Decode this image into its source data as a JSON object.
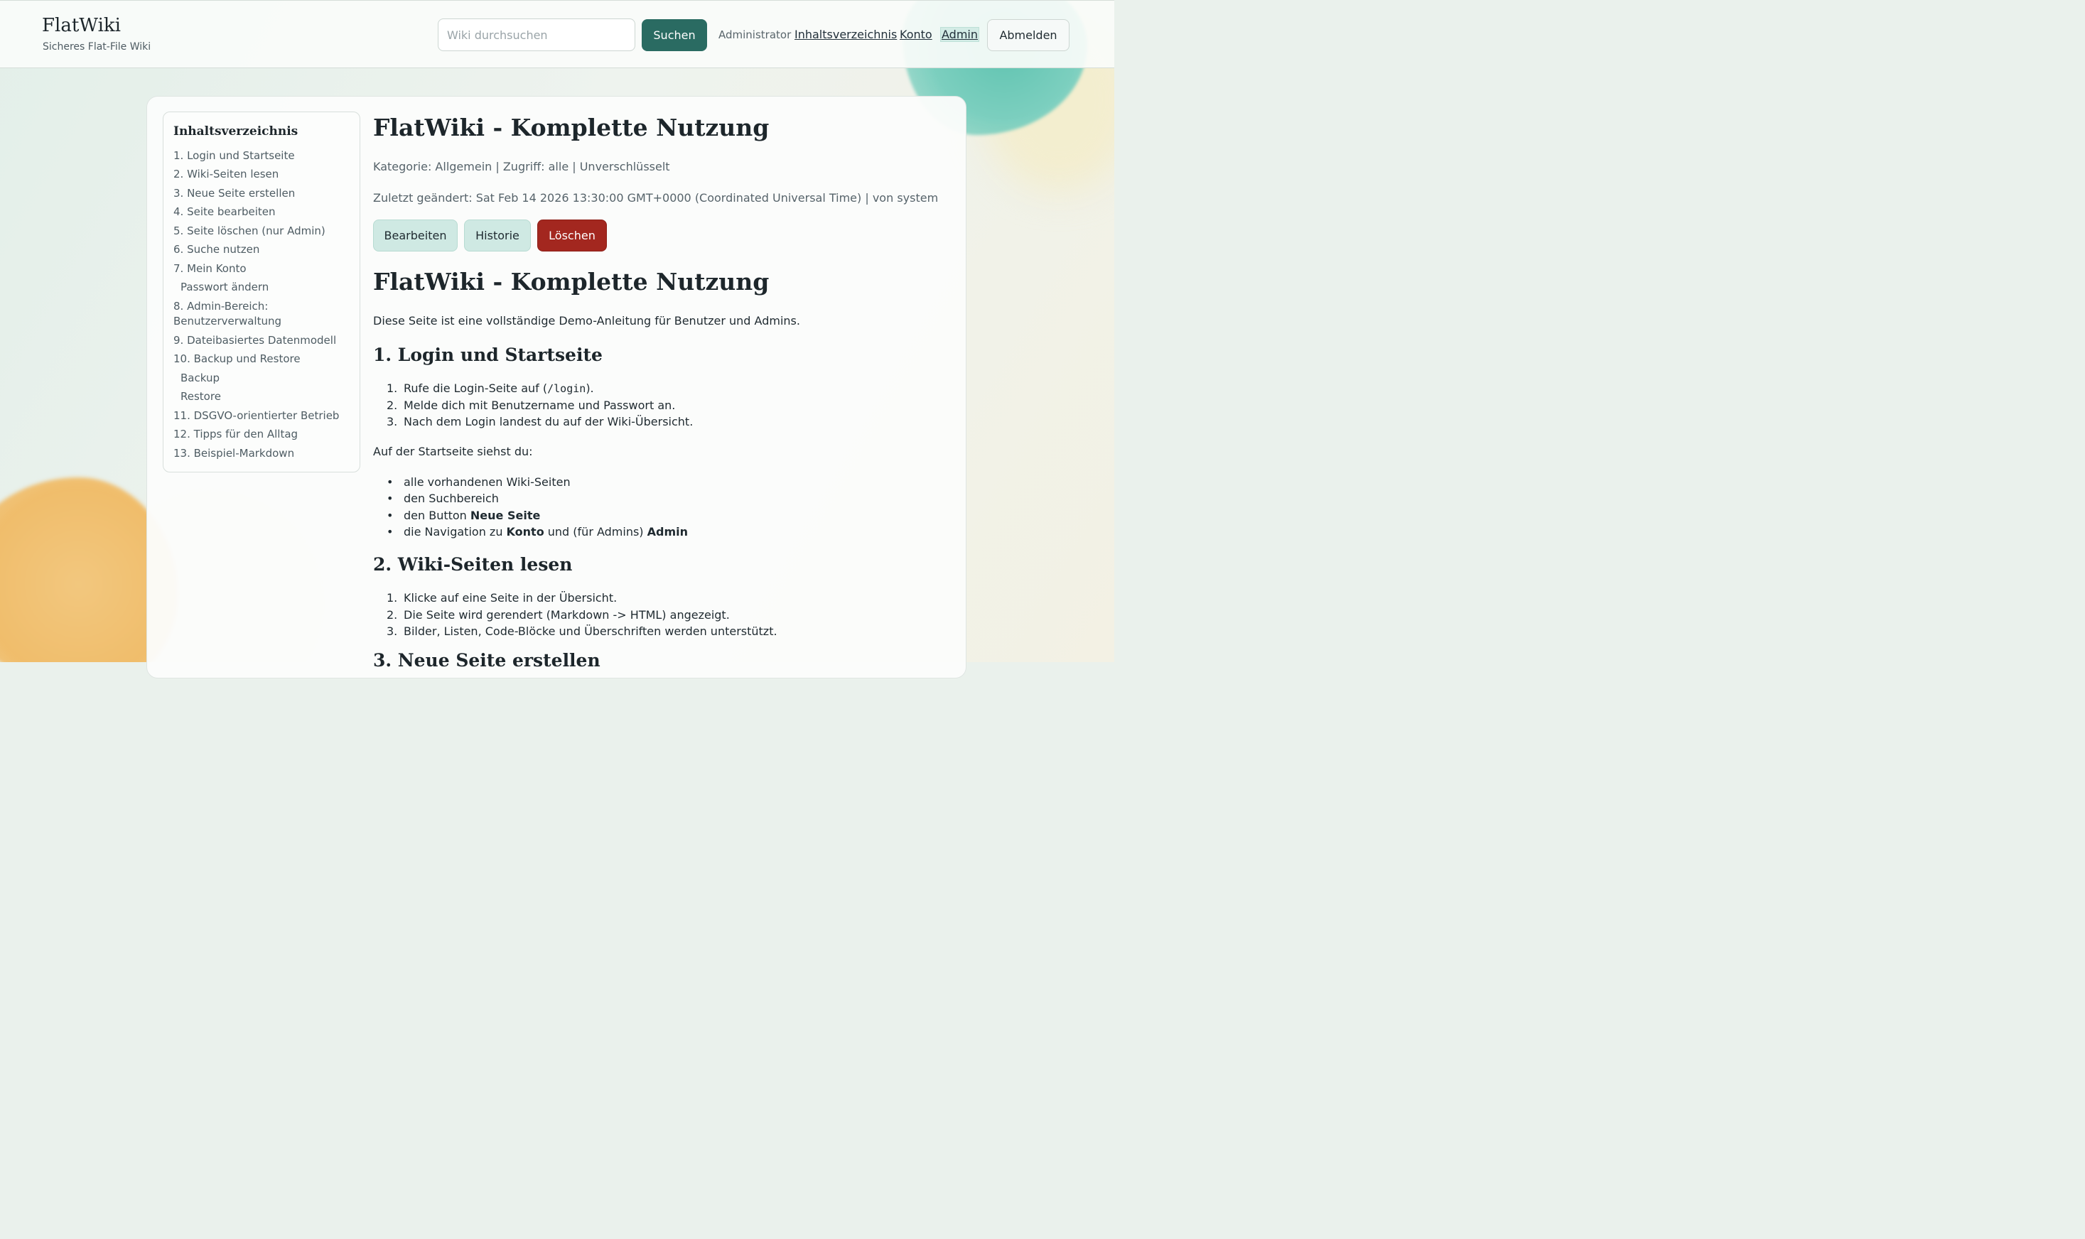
{
  "header": {
    "brand_title": "FlatWiki",
    "brand_subtitle": "Sicheres Flat-File Wiki",
    "search_placeholder": "Wiki durchsuchen",
    "search_button": "Suchen",
    "user": "Administrator",
    "nav": [
      "Inhaltsverzeichnis",
      "Konto",
      "Admin"
    ],
    "logout": "Abmelden"
  },
  "toc": {
    "title": "Inhaltsverzeichnis",
    "items": [
      "1. Login und Startseite",
      "2. Wiki-Seiten lesen",
      "3. Neue Seite erstellen",
      "4. Seite bearbeiten",
      "5. Seite löschen (nur Admin)",
      "6. Suche nutzen",
      "7. Mein Konto",
      "Passwort ändern",
      "8. Admin-Bereich: Benutzerverwaltung",
      "9. Dateibasiertes Datenmodell",
      "10. Backup und Restore",
      "Backup",
      "Restore",
      "11. DSGVO-orientierter Betrieb",
      "12. Tipps für den Alltag",
      "13. Beispiel-Markdown"
    ]
  },
  "page": {
    "title": "FlatWiki - Komplette Nutzung",
    "meta_category": "Kategorie: Allgemein | Zugriff: alle | Unverschlüsselt",
    "meta_changed": "Zuletzt geändert: Sat Feb 14 2026 13:30:00 GMT+0000 (Coordinated Universal Time) | von system",
    "actions": {
      "edit": "Bearbeiten",
      "history": "Historie",
      "delete": "Löschen"
    }
  },
  "content": {
    "h1": "FlatWiki - Komplette Nutzung",
    "intro": "Diese Seite ist eine vollständige Demo-Anleitung für Benutzer und Admins.",
    "section1": {
      "heading": "1. Login und Startseite",
      "steps": {
        "s1_prefix": "Rufe die Login-Seite auf (",
        "s1_code": "/login",
        "s1_suffix": ").",
        "s2": "Melde dich mit Benutzername und Passwort an.",
        "s3": "Nach dem Login landest du auf der Wiki-Übersicht."
      },
      "nums": [
        "1.",
        "2.",
        "3."
      ],
      "startpage_intro": "Auf der Startseite siehst du:",
      "bullets": {
        "b1": "alle vorhandenen Wiki-Seiten",
        "b2": "den Suchbereich",
        "b3_prefix": "den Button ",
        "b3_bold": "Neue Seite",
        "b4_prefix": "die Navigation zu ",
        "b4_bold1": "Konto",
        "b4_mid": " und (für Admins) ",
        "b4_bold2": "Admin"
      }
    },
    "section2": {
      "heading": "2. Wiki-Seiten lesen",
      "steps": [
        "Klicke auf eine Seite in der Übersicht.",
        "Die Seite wird gerendert (Markdown -> HTML) angezeigt.",
        "Bilder, Listen, Code-Blöcke und Überschriften werden unterstützt."
      ]
    },
    "section3_heading": "3. Neue Seite erstellen"
  }
}
